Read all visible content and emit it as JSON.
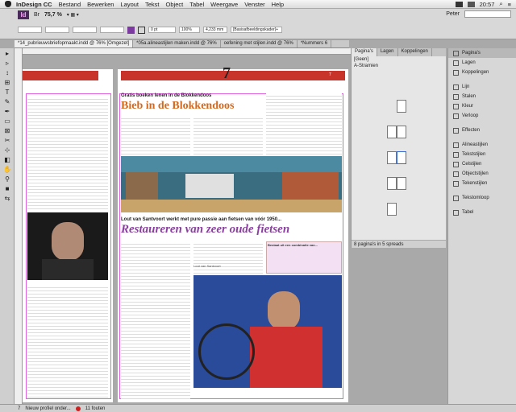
{
  "menubar": {
    "app": "InDesign CC",
    "items": [
      "Bestand",
      "Bewerken",
      "Layout",
      "Tekst",
      "Object",
      "Tabel",
      "Weergave",
      "Venster",
      "Help"
    ],
    "time": "20:57"
  },
  "control": {
    "logo": "Id",
    "zoom": "75,7 %",
    "user": "Peter",
    "stroke_weight": "0 pt",
    "opacity": "100%",
    "measure": "4,233 mm",
    "style": "[Basisafbeeldingskader]+"
  },
  "tabs": [
    "*14_pubrieuwsbriefopmaakt.indd @ 76% [Omgezet]",
    "*05a.alineastijlen maken.indd @ 76%",
    "oefening met stijlen.indd @ 76%",
    "*Nummers 6"
  ],
  "tools": [
    "▸",
    "▹",
    "↕",
    "⊞",
    "T",
    "✎",
    "✒",
    "▭",
    "⊠",
    "✂",
    "⊹",
    "◧",
    "✋",
    "⚲",
    "■",
    "⇆"
  ],
  "page": {
    "number": "7",
    "corner_number": "7",
    "kicker": "Gratis boeken lenen in de Blokkendoos",
    "headline": "Bieb in de Blokkendoos",
    "kicker2": "Lout van Santvoort werkt met pure passie aan fietsen van vóór 1950...",
    "headline2": "Restaureren van zeer oude fietsen",
    "subtitle": "Lout van Santvoort",
    "tip": "Bestaat uit een combinatie van..."
  },
  "pages_panel": {
    "tabs": [
      "Pagina's",
      "Lagen",
      "Koppelingen"
    ],
    "none": "[Geen]",
    "master": "A-Stramien",
    "footer": "8 pagina's in 5 spreads"
  },
  "right_panel": {
    "groups": [
      [
        "Pagina's",
        "Lagen",
        "Koppelingen"
      ],
      [
        "Lijn",
        "Stalen",
        "Kleur",
        "Verloop"
      ],
      [
        "Effecten"
      ],
      [
        "Alineastijlen",
        "Tekststijlen",
        "Celstijlen",
        "Objectstijlen",
        "Tekenstijlen"
      ],
      [
        "Tekstomloop"
      ],
      [
        "Tabel"
      ]
    ]
  },
  "status": {
    "page": "7",
    "profile": "Nieuw profiel onder...",
    "errors": "11 fouten"
  },
  "colors": {
    "accent_red": "#c8342a",
    "headline_orange": "#d2691e",
    "headline_purple": "#8a3fa0"
  }
}
